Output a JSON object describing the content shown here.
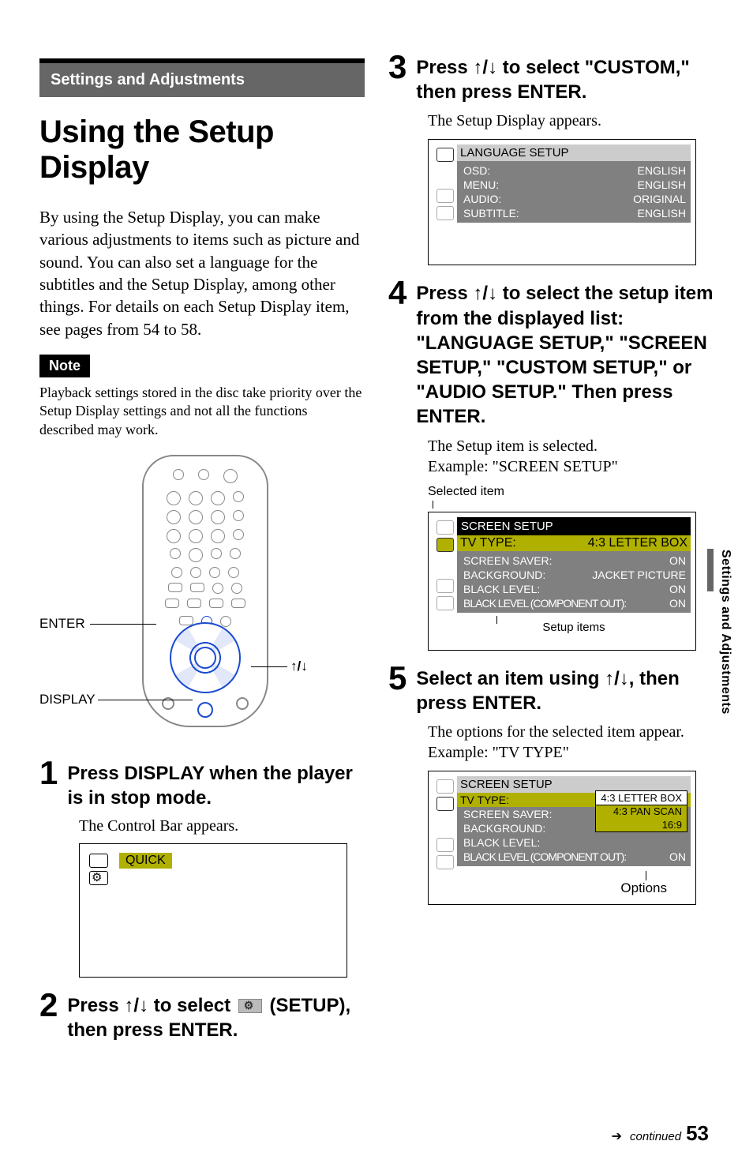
{
  "section_band": "Settings and Adjustments",
  "main_title": "Using the Setup Display",
  "intro": "By using the Setup Display, you can make various adjustments to items such as picture and sound. You can also set a language for the subtitles and the Setup Display, among other things. For details on each Setup Display item, see pages from 54 to 58.",
  "note_chip": "Note",
  "note_body": "Playback settings stored in the disc take priority over the Setup Display settings and not all the functions described may work.",
  "remote": {
    "enter": "ENTER",
    "display": "DISPLAY",
    "arrows": "↑/↓"
  },
  "steps": {
    "s1": {
      "n": "1",
      "t": "Press DISPLAY when the player is in stop mode.",
      "sub": "The Control Bar appears."
    },
    "s2": {
      "n": "2",
      "t_pre": "Press ↑/↓ to select ",
      "t_post": " (SETUP), then press ENTER."
    },
    "s3": {
      "n": "3",
      "t": "Press ↑/↓ to select \"CUSTOM,\" then press ENTER.",
      "sub": "The Setup Display appears."
    },
    "s4": {
      "n": "4",
      "t": "Press ↑/↓ to select the setup item from the displayed list: \"LANGUAGE SETUP,\" \"SCREEN SETUP,\" \"CUSTOM SETUP,\" or \"AUDIO SETUP.\" Then press ENTER.",
      "sub": "The Setup item is selected.\nExample: \"SCREEN SETUP\""
    },
    "s5": {
      "n": "5",
      "t": "Select an item using ↑/↓, then press ENTER.",
      "sub": "The options for the selected item appear. Example: \"TV TYPE\""
    }
  },
  "osd1": {
    "quick": "QUICK"
  },
  "osd2": {
    "title": "LANGUAGE SETUP",
    "rows": [
      {
        "k": "OSD:",
        "v": "ENGLISH"
      },
      {
        "k": "MENU:",
        "v": "ENGLISH"
      },
      {
        "k": "AUDIO:",
        "v": "ORIGINAL"
      },
      {
        "k": "SUBTITLE:",
        "v": "ENGLISH"
      }
    ]
  },
  "osd3": {
    "callout_top": "Selected item",
    "title": "SCREEN SETUP",
    "hl": {
      "k": "TV TYPE:",
      "v": "4:3 LETTER BOX"
    },
    "rows": [
      {
        "k": "SCREEN SAVER:",
        "v": "ON"
      },
      {
        "k": "BACKGROUND:",
        "v": "JACKET PICTURE"
      },
      {
        "k": "BLACK LEVEL:",
        "v": "ON"
      },
      {
        "k": "BLACK LEVEL (COMPONENT OUT):",
        "v": "ON"
      }
    ],
    "callout_mid": "Setup items"
  },
  "osd4": {
    "title": "SCREEN SETUP",
    "rows": [
      {
        "k": "TV TYPE:",
        "v": "4:3 LETTER BOX"
      },
      {
        "k": "SCREEN SAVER:",
        "v": ""
      },
      {
        "k": "BACKGROUND:",
        "v": ""
      },
      {
        "k": "BLACK LEVEL:",
        "v": ""
      },
      {
        "k": "BLACK LEVEL (COMPONENT OUT):",
        "v": "ON"
      }
    ],
    "opts": [
      "4:3 LETTER BOX",
      "4:3 PAN SCAN",
      "16:9"
    ],
    "callout": "Options"
  },
  "side_tab": "Settings and Adjustments",
  "footer": {
    "cont": "continued",
    "page": "53"
  }
}
